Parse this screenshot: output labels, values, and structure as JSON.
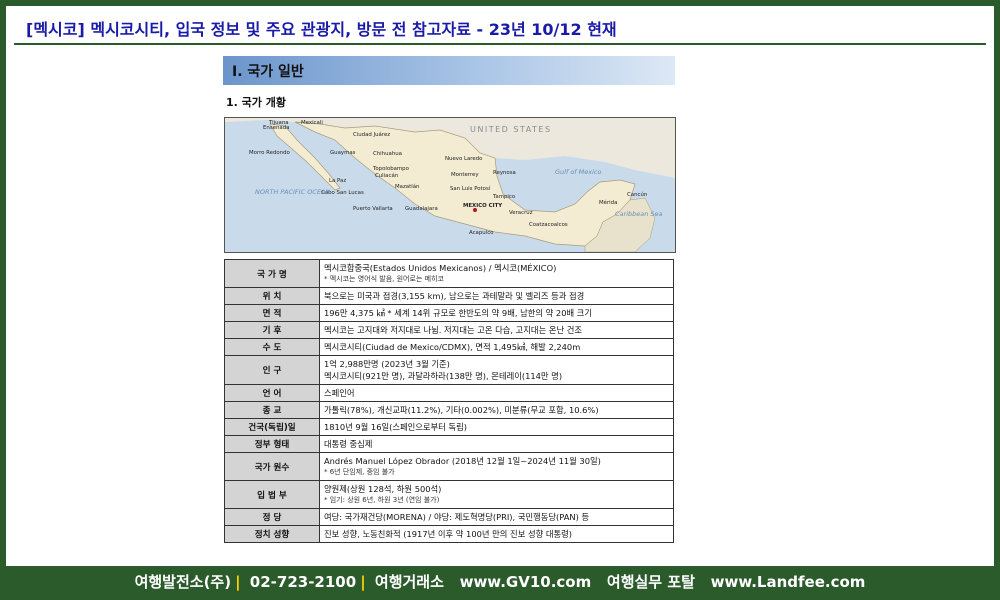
{
  "header": {
    "title": "[멕시코] 멕시코시티, 입국 정보 및 주요 관광지, 방문 전 참고자료 - 23년 10/12 현재"
  },
  "section": {
    "title": "I. 국가 일반",
    "subtitle": "1. 국가 개황"
  },
  "map": {
    "labels": {
      "us": "UNITED STATES",
      "tijuana": "Tijuana",
      "ensenada": "Ensenada",
      "mexicali": "Mexicali",
      "juarez": "Ciudad Juárez",
      "guaymas": "Guaymas",
      "chihuahua": "Chihuahua",
      "monterrey": "Monterrey",
      "nuevo_laredo": "Nuevo Laredo",
      "reynosa": "Reynosa",
      "culiacan": "Culiacán",
      "topolobampo": "Topolobampo",
      "la_paz": "La Paz",
      "cabo": "Cabo San Lucas",
      "mazatlan": "Mazatlán",
      "slp": "San Luis Potosí",
      "tampico": "Tampico",
      "puerto_vallarta": "Puerto Vallarta",
      "guadalajara": "Guadalajara",
      "mexico_city": "MEXICO CITY",
      "veracruz": "Veracruz",
      "acapulco": "Acapulco",
      "coatzacoalcos": "Coatzacoalcos",
      "merida": "Mérida",
      "cancun": "Cancún",
      "morro": "Morro Redondo",
      "gulf": "Gulf of Mexico",
      "caribbean": "Caribbean Sea",
      "pacific": "NORTH PACIFIC OCEAN"
    }
  },
  "table": [
    {
      "key": "국 가 명",
      "lines": [
        "멕시코합중국(Estados Unidos Mexicanos) / 멕시코(MÉXICO)"
      ],
      "note": "* 멕시코는 영어식 발음, 원어로는 메히코"
    },
    {
      "key": "위 치",
      "lines": [
        "북으로는 미국과 접경(3,155 km), 남으로는 과테말라 및 벨리즈 등과 접경"
      ]
    },
    {
      "key": "면 적",
      "lines": [
        "196만 4,375 ㎢ * 세계 14위 규모로 한반도의 약 9배, 남한의 약 20배 크기"
      ]
    },
    {
      "key": "기 후",
      "lines": [
        "멕시코는 고지대와 저지대로 나뉨. 저지대는 고온 다습, 고지대는 온난 건조"
      ]
    },
    {
      "key": "수 도",
      "lines": [
        "멕시코시티(Ciudad de Mexico/CDMX), 면적 1,495㎢, 해발 2,240m"
      ]
    },
    {
      "key": "인 구",
      "lines": [
        "1억 2,988만명 (2023년 3월 기준)",
        "멕시코시티(921만 명), 과달라하라(138만 명), 몬테레이(114만 명)"
      ]
    },
    {
      "key": "언 어",
      "lines": [
        "스페인어"
      ]
    },
    {
      "key": "종 교",
      "lines": [
        "가톨릭(78%), 개신교파(11.2%), 기타(0.002%), 미분류(무교 포함, 10.6%)"
      ]
    },
    {
      "key": "건국(독립)일",
      "lines": [
        "1810년 9월 16일(스페인으로부터 독립)"
      ]
    },
    {
      "key": "정부 형태",
      "lines": [
        "대통령 중심제"
      ]
    },
    {
      "key": "국가 원수",
      "lines": [
        "Andrés Manuel López Obrador (2018년 12월 1일~2024년 11월 30일)"
      ],
      "note": "* 6년 단임제, 중임 불가"
    },
    {
      "key": "입 법 부",
      "lines": [
        "양원제(상원 128석, 하원 500석)"
      ],
      "note": "* 임기: 상원 6년, 하원 3년 (연임 불가)"
    },
    {
      "key": "정 당",
      "lines": [
        "여당: 국가재건당(MORENA) / 야당: 제도혁명당(PRI), 국민행동당(PAN) 등"
      ]
    },
    {
      "key": "정치 성향",
      "lines": [
        "진보 성향, 노동친화적 (1917년 이후 약 100년 만의 진보 성향 대통령)"
      ]
    }
  ],
  "footer": {
    "company": "여행발전소(주)",
    "phone": "02-723-2100",
    "exchange": "여행거래소",
    "site1": "www.GV10.com",
    "portal": "여행실무 포탈",
    "site2": "www.Landfee.com"
  }
}
